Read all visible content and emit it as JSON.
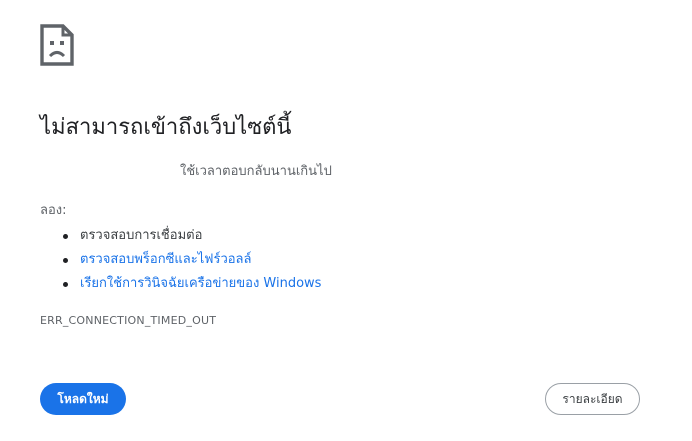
{
  "error_page": {
    "icon": "sad-page-icon",
    "title": "ไม่สามารถเข้าถึงเว็บไซต์นี้",
    "subtitle": "ใช้เวลาตอบกลับนานเกินไป",
    "try_label": "ลอง:",
    "suggestions": [
      {
        "text": "ตรวจสอบการเชื่อมต่อ",
        "is_link": false
      },
      {
        "text": "ตรวจสอบพร็อกซีและไฟร์วอลล์",
        "is_link": true
      },
      {
        "text": "เรียกใช้การวินิจฉัยเครือข่ายของ Windows",
        "is_link": true
      }
    ],
    "error_code": "ERR_CONNECTION_TIMED_OUT",
    "reload_button": "โหลดใหม่",
    "details_button": "รายละเอียด"
  },
  "colors": {
    "accent": "#1a73e8",
    "title_text": "#202124",
    "secondary_text": "#5f6368"
  }
}
